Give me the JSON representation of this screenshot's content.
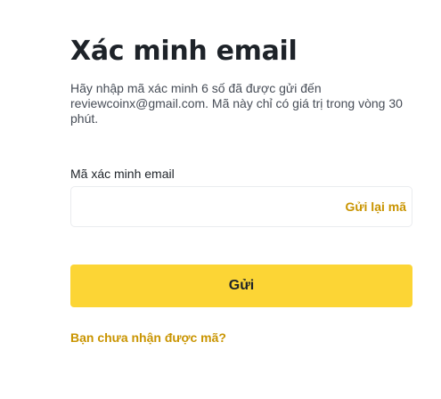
{
  "page": {
    "title": "Xác minh email",
    "description": "Hãy nhập mã xác minh 6 số đã được gửi đến reviewcoinx@gmail.com. Mã này chỉ có giá trị trong vòng 30 phút."
  },
  "form": {
    "code_label": "Mã xác minh email",
    "code_value": "",
    "code_placeholder": "",
    "resend_label": "Gửi lại mã",
    "submit_label": "Gửi",
    "help_link": "Bạn chưa nhận được mã?"
  },
  "colors": {
    "accent": "#c99400",
    "button": "#fcd535",
    "text": "#1e2329"
  }
}
